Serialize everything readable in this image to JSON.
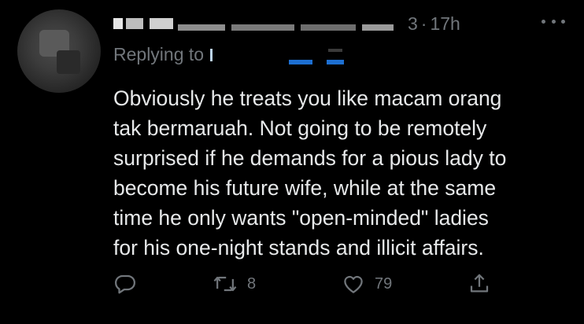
{
  "tweet": {
    "header": {
      "handle_tail": "3",
      "separator": "·",
      "time": "17h"
    },
    "replying_to_label": "Replying to",
    "text": "Obviously he treats you like macam orang\ntak bermaruah. Not going to be remotely\nsurprised if he demands for a pious lady to\nbecome his future wife, while at the same\ntime he only wants \"open-minded\" ladies\nfor his one-night stands and illicit affairs.",
    "actions": {
      "reply_icon": "reply-icon",
      "retweet_icon": "retweet-icon",
      "retweet_count": "8",
      "like_icon": "heart-icon",
      "like_count": "79",
      "share_icon": "share-icon"
    },
    "colors": {
      "background": "#000000",
      "text": "#e7e9ea",
      "secondary": "#71767b"
    }
  }
}
